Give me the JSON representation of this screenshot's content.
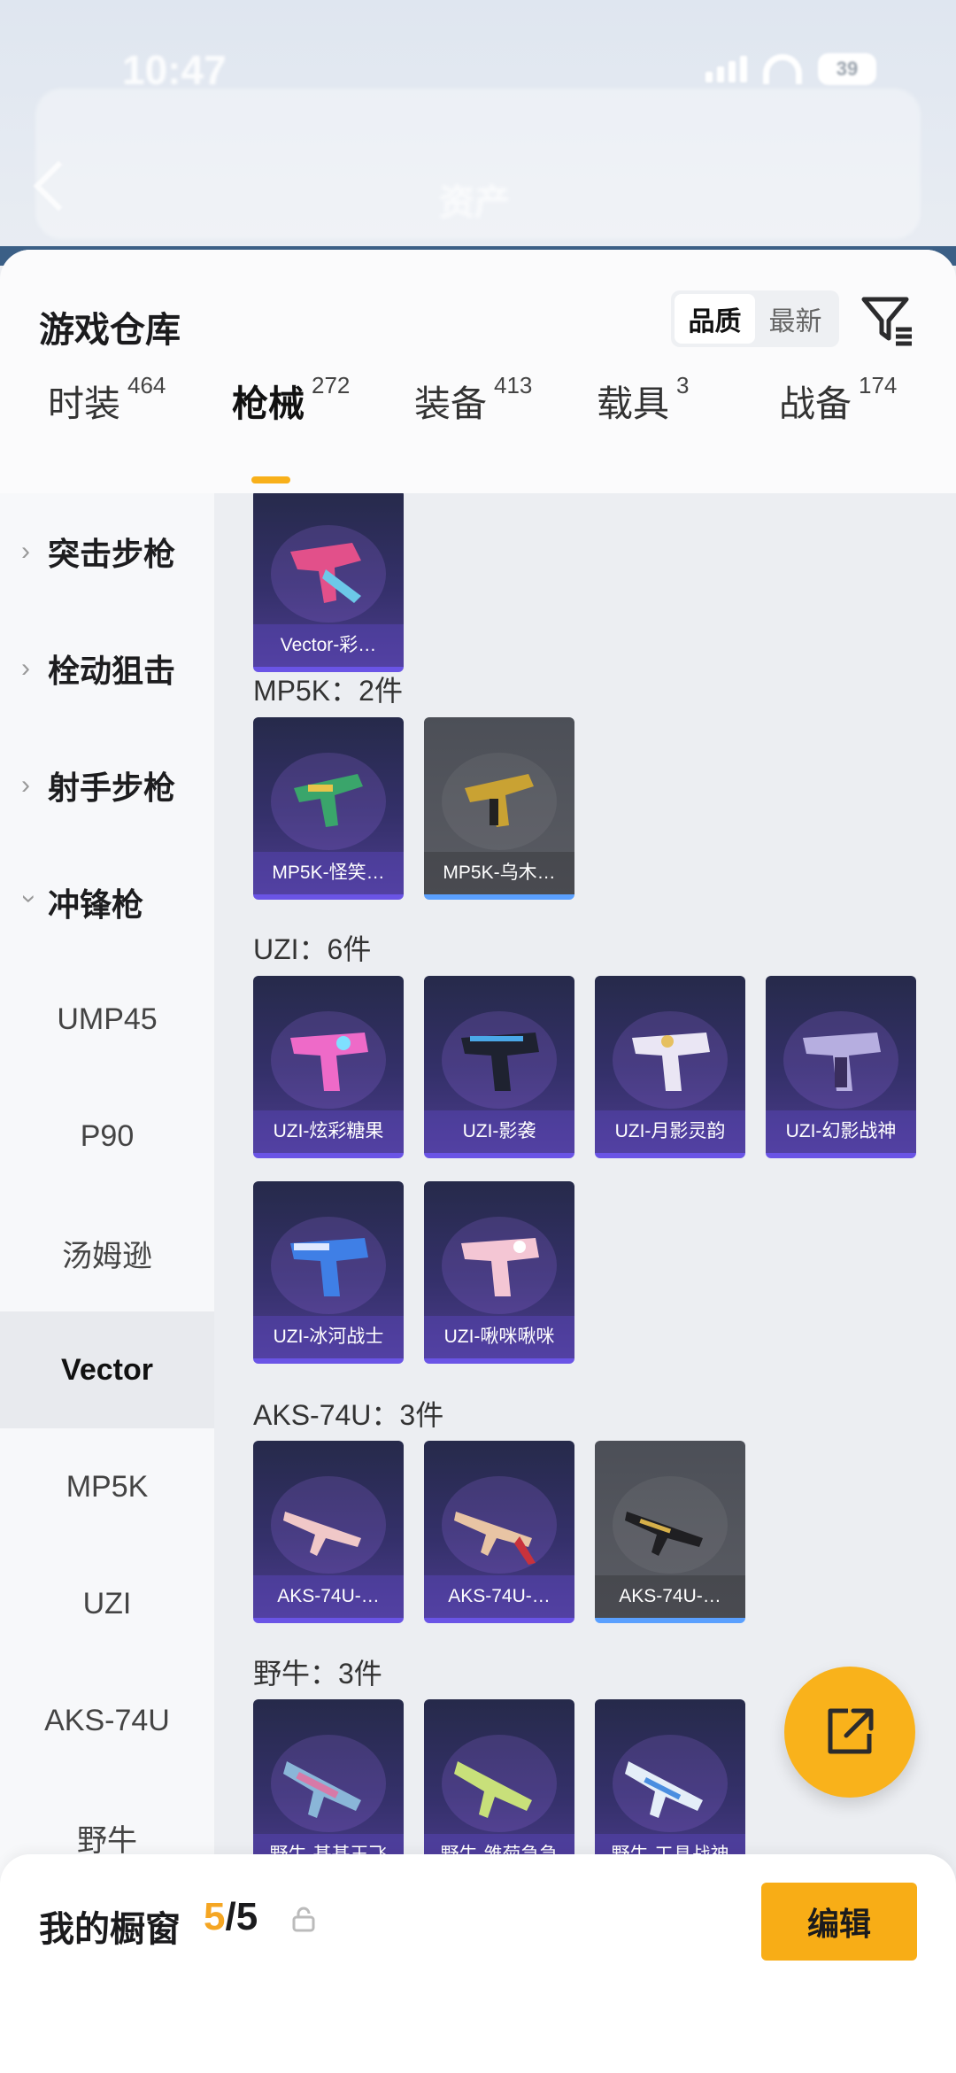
{
  "statusbar": {
    "time": "10:47",
    "battery": "39"
  },
  "nav": {
    "title": "资产"
  },
  "warehouse": {
    "title": "游戏仓库",
    "sort_options": [
      "品质",
      "最新"
    ],
    "active_sort": "品质",
    "filter_icon": "filter-icon"
  },
  "tabs": [
    {
      "label": "时装",
      "count": "464"
    },
    {
      "label": "枪械",
      "count": "272"
    },
    {
      "label": "装备",
      "count": "413"
    },
    {
      "label": "载具",
      "count": "3"
    },
    {
      "label": "战备",
      "count": "174"
    }
  ],
  "active_tab": "枪械",
  "categories": [
    {
      "label": "突击步枪",
      "expanded": false
    },
    {
      "label": "栓动狙击",
      "expanded": false
    },
    {
      "label": "射手步枪",
      "expanded": false
    },
    {
      "label": "冲锋枪",
      "expanded": true
    }
  ],
  "subcategories": [
    "UMP45",
    "P90",
    "汤姆逊",
    "Vector",
    "MP5K",
    "UZI",
    "AKS-74U",
    "野牛"
  ],
  "active_subcategory": "Vector",
  "groups": [
    {
      "title": "",
      "items": [
        "Vector-彩…"
      ]
    },
    {
      "title": "MP5K：2件",
      "items": [
        "MP5K-怪笑…",
        "MP5K-乌木…"
      ]
    },
    {
      "title": "UZI：6件",
      "items": [
        "UZI-炫彩糖果",
        "UZI-影袭",
        "UZI-月影灵韵",
        "UZI-幻影战神",
        "UZI-冰河战士",
        "UZI-啾咪啾咪"
      ]
    },
    {
      "title": "AKS-74U：3件",
      "items": [
        "AKS-74U-…",
        "AKS-74U-…",
        "AKS-74U-…"
      ]
    },
    {
      "title": "野牛：3件",
      "items": [
        "野牛-基基王飞",
        "野牛-雏菊急急",
        "野牛-工具战神"
      ]
    }
  ],
  "fab_icon": "share-out-icon",
  "showcase": {
    "title": "我的橱窗",
    "current": "5",
    "total": "/5",
    "lock_icon": "lock-icon",
    "edit_label": "编辑"
  },
  "colors": {
    "accent": "#f8ad16",
    "card_purple": "#34306a",
    "card_grey": "#55575e"
  }
}
